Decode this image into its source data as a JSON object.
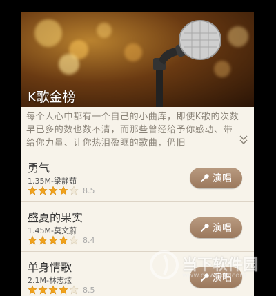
{
  "banner": {
    "title": "K歌金榜"
  },
  "description": {
    "text": "每个人心中都有一个自己的小曲库，即使K歌的次数早已多的数也数不清，而那些曾经给予你感动、带给你力量、让你热泪盈眶的歌曲，仍旧",
    "expand_icon": "chevron-double-down-icon"
  },
  "songs": [
    {
      "title": "勇气",
      "meta": "1.35M-梁静茹",
      "stars": 4,
      "rating": "8.5",
      "button": "演唱"
    },
    {
      "title": "盛夏的果实",
      "meta": "1.45M-莫文蔚",
      "stars": 4,
      "rating": "8.4",
      "button": "演唱"
    },
    {
      "title": "单身情歌",
      "meta": "2.1M-林志炫",
      "stars": 4,
      "rating": "8.5",
      "button": "演唱"
    }
  ],
  "watermark": {
    "text": "当下软件园",
    "url": "www.downxia.com"
  },
  "colors": {
    "star": "#f0a21c",
    "button": "#a5846a",
    "background": "#f7f3ea"
  }
}
